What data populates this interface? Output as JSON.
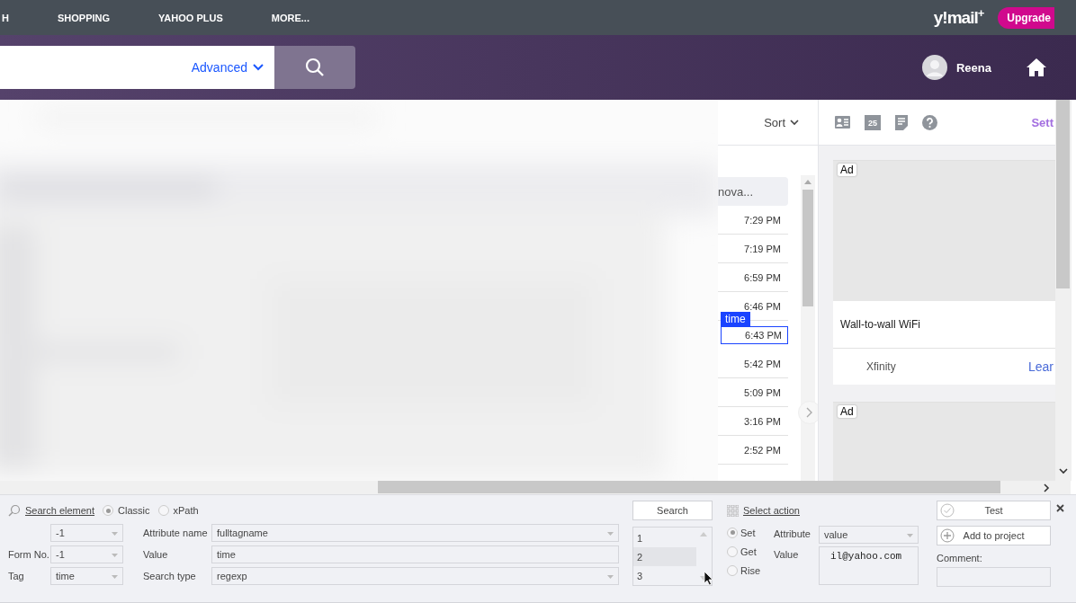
{
  "top_nav": {
    "items": [
      "H",
      "SHOPPING",
      "YAHOO PLUS",
      "MORE..."
    ],
    "logo": "y!mail",
    "logo_mark": "+",
    "upgrade": "Upgrade"
  },
  "search": {
    "advanced": "Advanced"
  },
  "user": {
    "name": "Reena"
  },
  "message_list": {
    "sort": "Sort",
    "preview": "nova...",
    "element_label": "time",
    "rows": [
      {
        "time": "7:29 PM",
        "selected": false
      },
      {
        "time": "7:19 PM",
        "selected": false
      },
      {
        "time": "6:59 PM",
        "selected": false
      },
      {
        "time": "6:46 PM",
        "selected": false
      },
      {
        "time": "6:43 PM",
        "selected": true
      },
      {
        "time": "5:42 PM",
        "selected": false
      },
      {
        "time": "5:09 PM",
        "selected": false
      },
      {
        "time": "3:16 PM",
        "selected": false
      },
      {
        "time": "2:52 PM",
        "selected": false
      }
    ]
  },
  "right_pane": {
    "settings": "Sett",
    "calendar_day": "25",
    "ads": [
      {
        "badge": "Ad",
        "title": "Wall-to-wall WiFi",
        "sponsor": "Xfinity",
        "link": "Lear"
      },
      {
        "badge": "Ad"
      }
    ]
  },
  "element_panel": {
    "search_link": "Search element",
    "modes": [
      {
        "label": "Classic",
        "selected": true
      },
      {
        "label": "xPath",
        "selected": false
      }
    ],
    "left_fields": [
      {
        "value": "-1"
      },
      {
        "label": "Form No.",
        "value": "-1"
      },
      {
        "label": "Tag",
        "value": "time"
      }
    ],
    "attr_fields": [
      {
        "label": "Attribute name",
        "value": "fulltagname",
        "kind": "dropdown"
      },
      {
        "label": "Value",
        "value": "time",
        "kind": "text"
      },
      {
        "label": "Search type",
        "value": "regexp",
        "kind": "dropdown"
      }
    ],
    "search_button": "Search",
    "results": [
      {
        "label": "1",
        "selected": false
      },
      {
        "label": "2",
        "selected": true
      },
      {
        "label": "3",
        "selected": false
      }
    ],
    "action_link": "Select action",
    "actions": [
      {
        "label": "Set",
        "selected": true
      },
      {
        "label": "Get",
        "selected": false
      },
      {
        "label": "Rise",
        "selected": false
      }
    ],
    "attribute_label": "Attribute",
    "attribute_value": "value",
    "value_label": "Value",
    "value": "il@yahoo.com",
    "test_button": "Test",
    "add_button": "Add to project",
    "comment_label": "Comment:"
  }
}
